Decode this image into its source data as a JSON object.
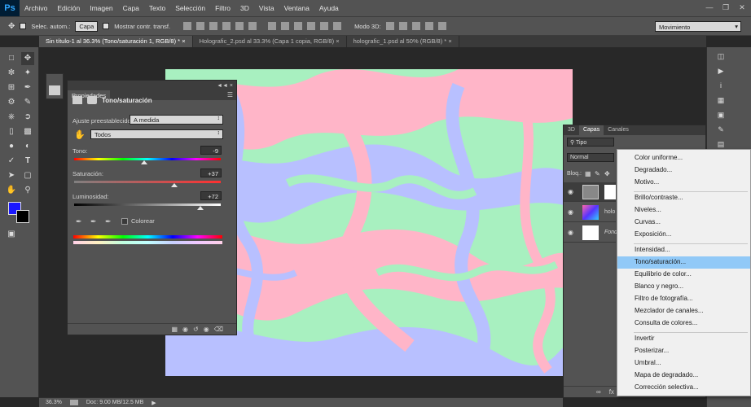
{
  "app": {
    "logo": "Ps"
  },
  "menubar": [
    "Archivo",
    "Edición",
    "Imagen",
    "Capa",
    "Texto",
    "Selección",
    "Filtro",
    "3D",
    "Vista",
    "Ventana",
    "Ayuda"
  ],
  "options": {
    "autoselect_label": "Selec. autom.:",
    "autoselect_value": "Capa",
    "transform_label": "Mostrar contr. transf.",
    "mode3d_label": "Modo 3D:",
    "workspace": "Movimiento"
  },
  "tabs": [
    "Sin título-1 al 36.3% (Tono/saturación 1, RGB/8) *",
    "Holografic_2.psd al 33.3% (Capa 1 copia, RGB/8)",
    "holografic_1.psd al 50% (RGB/8) *"
  ],
  "properties": {
    "tab": "Propiedades",
    "title": "Tono/saturación",
    "preset_label": "Ajuste preestablecido:",
    "preset_value": "A medida",
    "channel_value": "Todos",
    "hue_label": "Tono:",
    "hue_value": "-9",
    "hue": -9,
    "sat_label": "Saturación:",
    "sat_value": "+37",
    "saturation": 37,
    "light_label": "Luminosidad:",
    "light_value": "+72",
    "lightness": 72,
    "colorize_label": "Colorear"
  },
  "layers": {
    "tabs": [
      "3D",
      "Capas",
      "Canales"
    ],
    "filter_value": "Tipo",
    "blend_value": "Normal",
    "lock_label": "Bloq.:",
    "rows": [
      {
        "name": ""
      },
      {
        "name": "holo"
      },
      {
        "name": "Fondo"
      }
    ]
  },
  "dropdown_menu": {
    "groups": [
      [
        "Color uniforme...",
        "Degradado...",
        "Motivo..."
      ],
      [
        "Brillo/contraste...",
        "Niveles...",
        "Curvas...",
        "Exposición..."
      ],
      [
        "Intensidad...",
        "Tono/saturación...",
        "Equilibrio de color...",
        "Blanco y negro...",
        "Filtro de fotografía...",
        "Mezclador de canales...",
        "Consulta de colores..."
      ],
      [
        "Invertir",
        "Posterizar...",
        "Umbral...",
        "Mapa de degradado...",
        "Corrección selectiva..."
      ]
    ],
    "selected": "Tono/saturación..."
  },
  "status": {
    "zoom": "36.3%",
    "doc": "Doc: 9.00 MB/12.5 MB"
  },
  "colors": {
    "foreground": "#1a18ff",
    "background": "#000000",
    "pink": "#ffb5c8",
    "mint": "#a8f0c0",
    "lavender": "#b8c0ff",
    "menu_highlight": "#91c9f7"
  }
}
